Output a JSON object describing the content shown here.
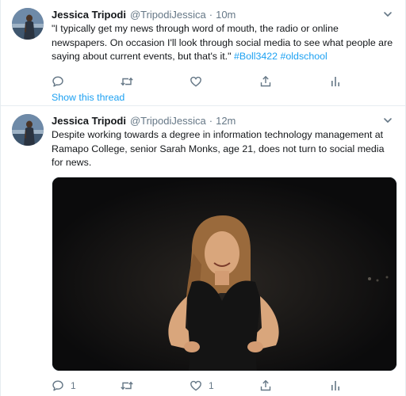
{
  "tweets": [
    {
      "author_name": "Jessica Tripodi",
      "handle": "@TripodiJessica",
      "separator": "·",
      "time": "10m",
      "text": "\"I typically get my news through word of mouth, the radio or online newspapers. On occasion I'll look through social media to see what people are saying about current events, but that's it.\"",
      "hashtags": [
        "#Boll3422",
        "#oldschool"
      ],
      "reply_count": "",
      "retweet_count": "",
      "like_count": "",
      "show_thread_label": "Show this thread"
    },
    {
      "author_name": "Jessica Tripodi",
      "handle": "@TripodiJessica",
      "separator": "·",
      "time": "12m",
      "text": "Despite working towards a degree in information technology management at Ramapo College, senior Sarah Monks, age 21, does not turn to social media for news.",
      "reply_count": "1",
      "retweet_count": "",
      "like_count": "1"
    }
  ],
  "icons": {
    "reply": "speech-bubble-icon",
    "retweet": "retweet-icon",
    "like": "heart-icon",
    "share": "share-icon",
    "analytics": "analytics-icon",
    "menu": "chevron-down-icon"
  },
  "colors": {
    "accent": "#1da1f2",
    "secondary_text": "#657786",
    "primary_text": "#14171a",
    "divider": "#e6ecf0"
  }
}
